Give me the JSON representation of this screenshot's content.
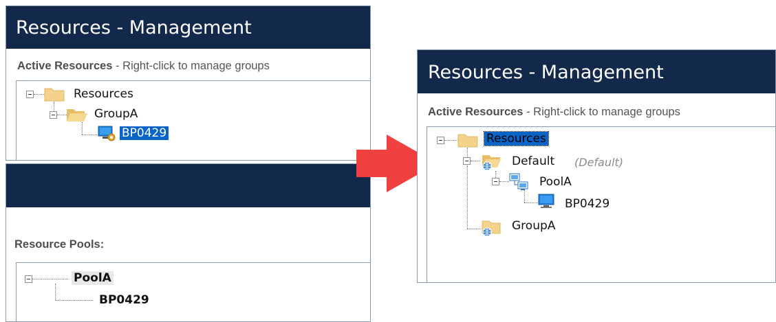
{
  "top_left": {
    "title": "Resources - Management",
    "hint_bold": "Active Resources",
    "hint_text": " - Right-click to manage groups",
    "tree": {
      "root": "Resources",
      "group": "GroupA",
      "resource": "BP0429"
    }
  },
  "bottom_left": {
    "section_label": "Resource Pools:",
    "tree": {
      "pool": "PoolA",
      "resource": "BP0429"
    }
  },
  "right": {
    "title": "Resources - Management",
    "hint_bold": "Active Resources",
    "hint_text": " - Right-click to manage groups",
    "tree": {
      "root": "Resources",
      "default_group": "Default",
      "default_tag": "(Default)",
      "pool": "PoolA",
      "resource": "BP0429",
      "group": "GroupA"
    }
  },
  "colors": {
    "title_bg": "#13294b",
    "selection": "#0a64c8",
    "arrow": "#f04040"
  },
  "icons": [
    "folder-icon",
    "open-folder-icon",
    "computer-icon",
    "computer-gear-icon",
    "pool-icon",
    "group-globe-icon",
    "arrow-right-icon"
  ]
}
